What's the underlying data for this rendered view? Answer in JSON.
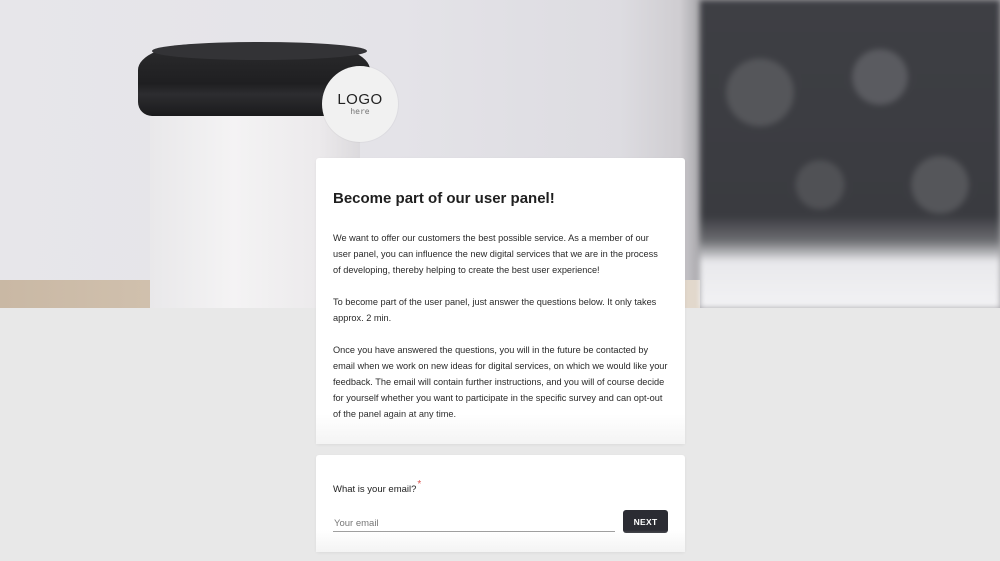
{
  "logo": {
    "main": "LOGO",
    "sub": "here"
  },
  "intro": {
    "title": "Become part of our user panel!",
    "paragraphs": [
      "We want to offer our customers the best possible service. As a member of our user panel, you can influence the new digital services that we are in the process of developing, thereby helping to create the best user experience!",
      "To become part of the user panel, just answer the questions below. It only takes approx. 2 min.",
      "Once you have answered the questions, you will in the future be contacted by email when we work on new ideas for digital services, on which we would like your feedback. The email will contain further instructions, and you will of course decide for yourself whether you want to participate in the specific survey and can opt-out of the panel again at any time."
    ]
  },
  "question": {
    "label": "What is your email?",
    "required_mark": "*",
    "placeholder": "Your email",
    "value": "",
    "next_label": "NEXT"
  },
  "colors": {
    "button_bg": "#2b2c33",
    "required": "#d9534f",
    "page_bg": "#e8e8e8"
  }
}
